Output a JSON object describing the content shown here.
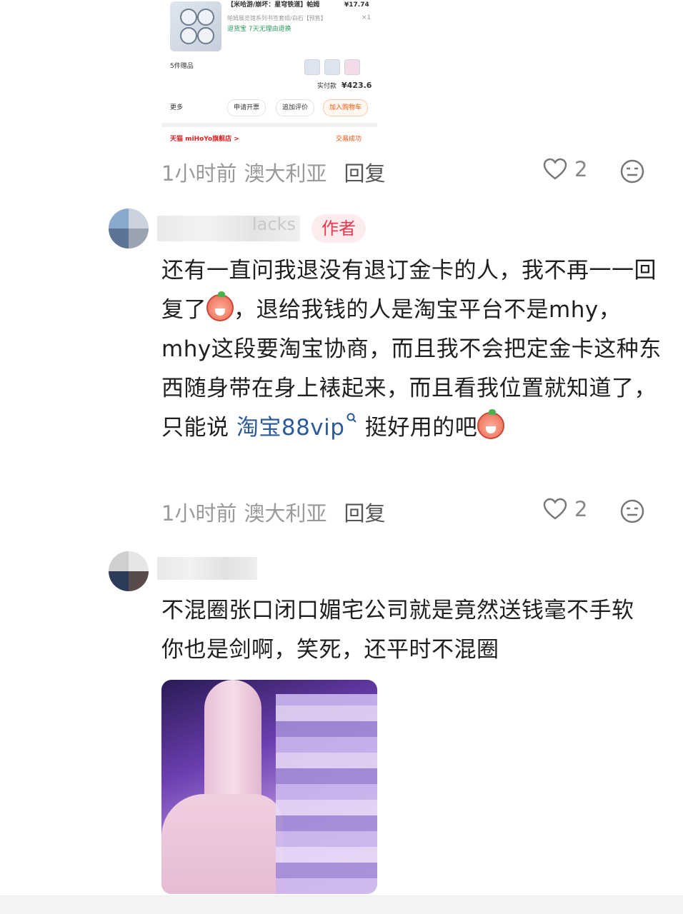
{
  "order_screenshot": {
    "product_title": "【米哈游/崩坏：星穹铁道】帕姆",
    "product_price": "¥17.74",
    "product_spec": "帕姆展览馆系列书签套组/白石【预售】",
    "product_qty": "×1",
    "service_tags": "退货宝  7天无理由退换",
    "gifts_label": "5件赠品",
    "paid_label": "实付款",
    "paid_amount": "¥423.6",
    "more_label": "更多",
    "buttons": [
      "申请开票",
      "追加评价",
      "加入购物车"
    ],
    "store_name": "天猫 miHoYo旗舰店 >",
    "store_status": "交易成功"
  },
  "comments": [
    {
      "time": "1小时前",
      "location": "澳大利亚",
      "reply_label": "回复",
      "likes": "2"
    },
    {
      "username": "lacks",
      "author_badge": "作者",
      "text_parts": {
        "p1": "还有一直问我退没有退订金卡的人，我不再一一回复了",
        "p2": "，退给我钱的人是淘宝平台不是mhy，mhy这段要淘宝协商，而且我不会把定金卡这种东西随身带在身上裱起来，而且看我位置就知道了，只能说 ",
        "link": "淘宝88vip",
        "p3": " 挺好用的吧"
      },
      "time": "1小时前",
      "location": "澳大利亚",
      "reply_label": "回复",
      "likes": "2"
    },
    {
      "text": "不混圈张口闭口媚宅公司就是竟然送钱毫不手软你也是剑啊，笑死，还平时不混圈"
    }
  ]
}
